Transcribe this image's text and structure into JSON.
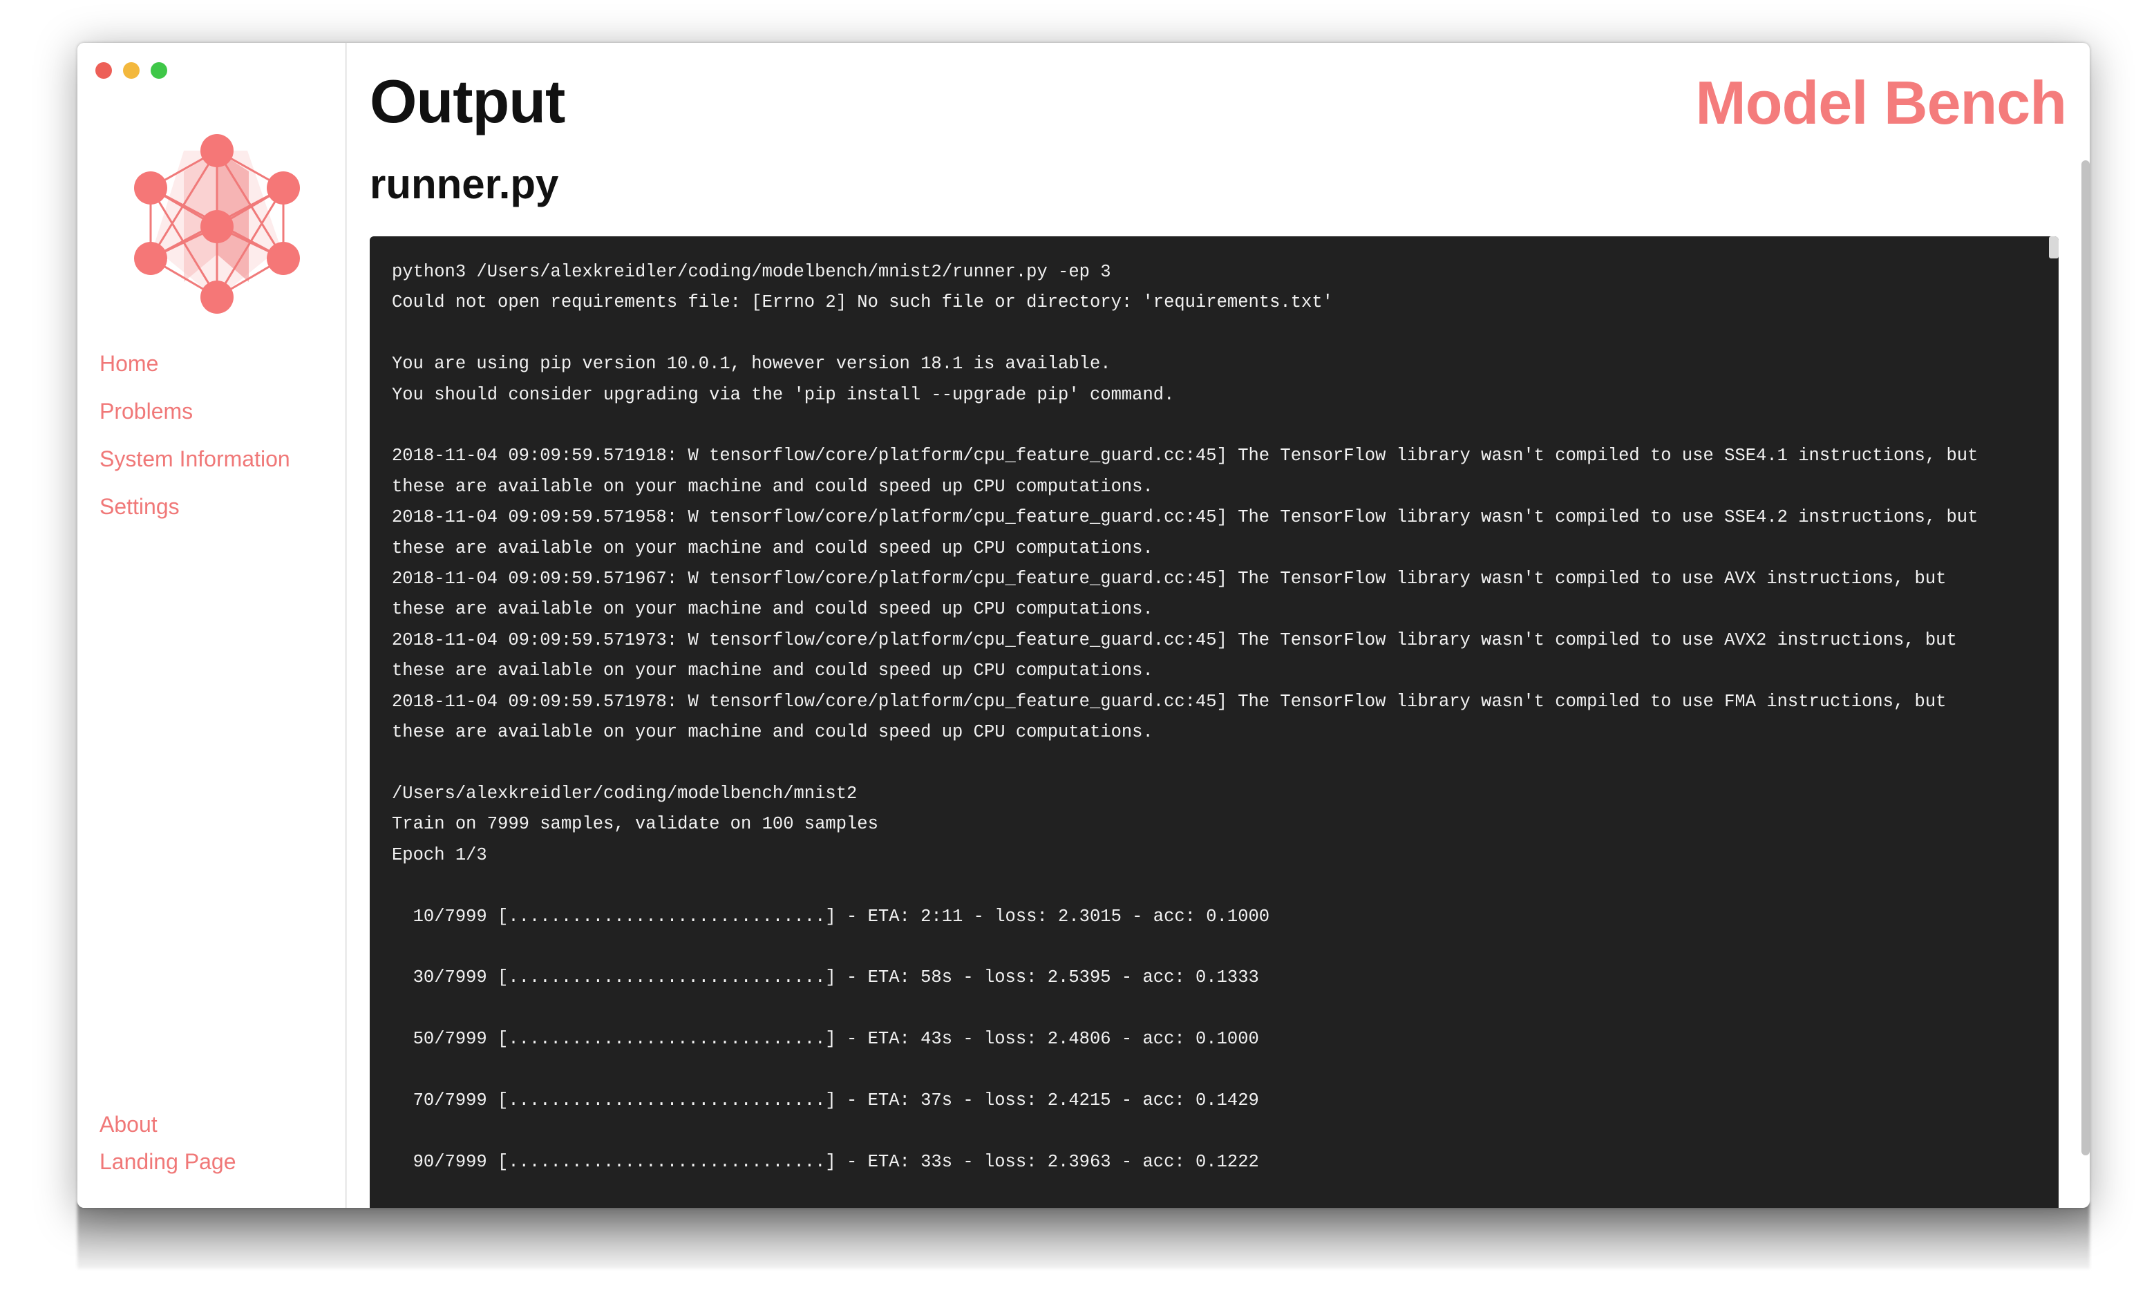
{
  "app": {
    "name": "Model Bench",
    "page_title": "Output",
    "file_name": "runner.py",
    "accent_color": "#f47c7c"
  },
  "window_controls": [
    "close",
    "minimize",
    "maximize"
  ],
  "sidebar": {
    "logo_icon": "neural-network-icon",
    "items": [
      {
        "label": "Home"
      },
      {
        "label": "Problems"
      },
      {
        "label": "System Information"
      },
      {
        "label": "Settings"
      }
    ],
    "bottom_items": [
      {
        "label": "About"
      },
      {
        "label": "Landing Page"
      }
    ]
  },
  "terminal": {
    "lines": [
      "python3 /Users/alexkreidler/coding/modelbench/mnist2/runner.py -ep 3",
      "Could not open requirements file: [Errno 2] No such file or directory: 'requirements.txt'",
      "",
      "You are using pip version 10.0.1, however version 18.1 is available.",
      "You should consider upgrading via the 'pip install --upgrade pip' command.",
      "",
      "2018-11-04 09:09:59.571918: W tensorflow/core/platform/cpu_feature_guard.cc:45] The TensorFlow library wasn't compiled to use SSE4.1 instructions, but",
      "these are available on your machine and could speed up CPU computations.",
      "2018-11-04 09:09:59.571958: W tensorflow/core/platform/cpu_feature_guard.cc:45] The TensorFlow library wasn't compiled to use SSE4.2 instructions, but",
      "these are available on your machine and could speed up CPU computations.",
      "2018-11-04 09:09:59.571967: W tensorflow/core/platform/cpu_feature_guard.cc:45] The TensorFlow library wasn't compiled to use AVX instructions, but",
      "these are available on your machine and could speed up CPU computations.",
      "2018-11-04 09:09:59.571973: W tensorflow/core/platform/cpu_feature_guard.cc:45] The TensorFlow library wasn't compiled to use AVX2 instructions, but",
      "these are available on your machine and could speed up CPU computations.",
      "2018-11-04 09:09:59.571978: W tensorflow/core/platform/cpu_feature_guard.cc:45] The TensorFlow library wasn't compiled to use FMA instructions, but",
      "these are available on your machine and could speed up CPU computations.",
      "",
      "/Users/alexkreidler/coding/modelbench/mnist2",
      "Train on 7999 samples, validate on 100 samples",
      "Epoch 1/3",
      "",
      "  10/7999 [..............................] - ETA: 2:11 - loss: 2.3015 - acc: 0.1000",
      "",
      "  30/7999 [..............................] - ETA: 58s - loss: 2.5395 - acc: 0.1333",
      "",
      "  50/7999 [..............................] - ETA: 43s - loss: 2.4806 - acc: 0.1000",
      "",
      "  70/7999 [..............................] - ETA: 37s - loss: 2.4215 - acc: 0.1429",
      "",
      "  90/7999 [..............................] - ETA: 33s - loss: 2.3963 - acc: 0.1222"
    ]
  }
}
